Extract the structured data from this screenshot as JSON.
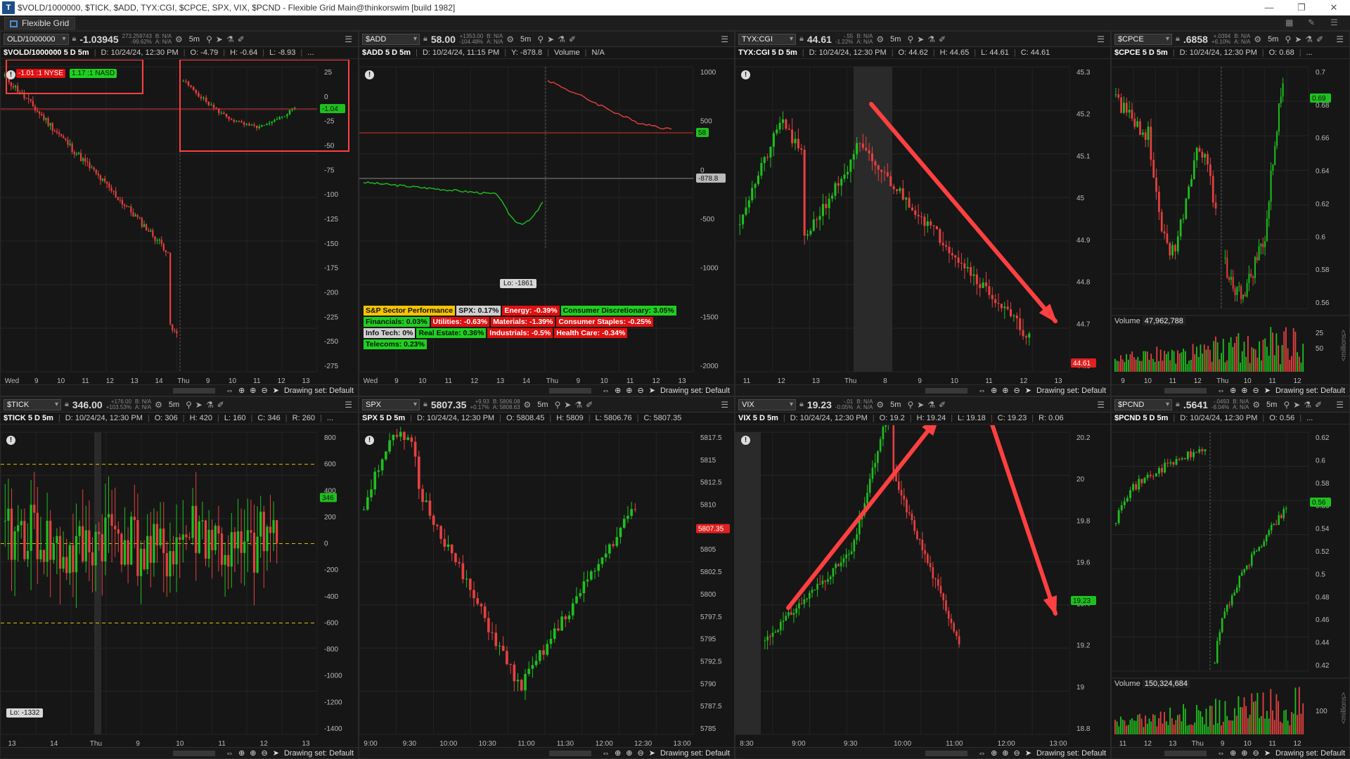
{
  "window": {
    "title": "$VOLD/1000000, $TICK, $ADD, TYX:CGI, $CPCE, SPX, VIX, $PCND - Flexible Grid Main@thinkorswim [build 1982]",
    "tab_label": "Flexible Grid"
  },
  "panels": [
    {
      "id": "vold",
      "symbol": "OLD/1000000",
      "last": "-1.03945",
      "change_top": "273.259743",
      "change_bottom": "-99.62%",
      "bid": "B: N/A",
      "ask": "A: N/A",
      "aggregation": "5m",
      "study_title": "$VOLD/1000000 5 D 5m",
      "fields": [
        "D: 10/24/24, 12:30 PM",
        "O: -4.79",
        "H: -0.64",
        "L: -8.93",
        "..."
      ],
      "x_ticks": [
        "Wed",
        "9",
        "10",
        "11",
        "12",
        "13",
        "14",
        "Thu",
        "9",
        "10",
        "11",
        "12",
        "13"
      ],
      "y_ticks": [
        "25",
        "0",
        "-25",
        "-50",
        "-75",
        "-100",
        "-125",
        "-150",
        "-175",
        "-200",
        "-225",
        "-250",
        "-275"
      ],
      "price_badge": "-1.04",
      "breadth_labels": [
        "-1.01 :1 NYSE",
        "1.17 :1 NASD"
      ]
    },
    {
      "id": "add",
      "symbol": "$ADD",
      "last": "58.00",
      "change_top": "+1353.00",
      "change_bottom": "-104.48%",
      "bid": "B: N/A",
      "ask": "A: N/A",
      "aggregation": "5m",
      "study_title": "$ADD 5 D 5m",
      "fields": [
        "D: 10/24/24, 11:15 PM",
        "Y: -878.8",
        "Volume",
        "N/A"
      ],
      "x_ticks": [
        "Wed",
        "9",
        "10",
        "11",
        "12",
        "13",
        "14",
        "Thu",
        "9",
        "10",
        "11",
        "12",
        "13"
      ],
      "y_ticks": [
        "1000",
        "500",
        "0",
        "-500",
        "-1000",
        "-1500",
        "-2000"
      ],
      "price_badge": "58",
      "ref_badge": "-878.8",
      "lo_label": "Lo: -1861",
      "sector_rows": [
        [
          {
            "text": "S&P Sector Performance",
            "bg": "#f5c400",
            "fg": "#111"
          },
          {
            "text": "SPX: 0.17%",
            "bg": "#d0d0d0",
            "fg": "#111"
          },
          {
            "text": "Energy: -0.39%",
            "bg": "#e01010",
            "fg": "#fff"
          },
          {
            "text": "Consumer Discretionary: 3.05%",
            "bg": "#1ed01e",
            "fg": "#111"
          }
        ],
        [
          {
            "text": "Financials: 0.03%",
            "bg": "#1ed01e",
            "fg": "#111"
          },
          {
            "text": "Utilities: -0.63%",
            "bg": "#e01010",
            "fg": "#fff"
          },
          {
            "text": "Materials: -1.39%",
            "bg": "#e01010",
            "fg": "#fff"
          },
          {
            "text": "Consumer Staples: -0.25%",
            "bg": "#e01010",
            "fg": "#fff"
          }
        ],
        [
          {
            "text": "Info Tech: 0%",
            "bg": "#d0d0d0",
            "fg": "#111"
          },
          {
            "text": "Real Estate: 0.36%",
            "bg": "#1ed01e",
            "fg": "#111"
          },
          {
            "text": "Industrials: -0.5%",
            "bg": "#e01010",
            "fg": "#fff"
          },
          {
            "text": "Health Care: -0.34%",
            "bg": "#e01010",
            "fg": "#fff"
          }
        ],
        [
          {
            "text": "Telecoms: 0.23%",
            "bg": "#1ed01e",
            "fg": "#111"
          }
        ]
      ]
    },
    {
      "id": "tyx",
      "symbol": "TYX:CGI",
      "last": "44.61",
      "change_top": "-.55",
      "change_bottom": "-1.22%",
      "bid": "B: N/A",
      "ask": "A: N/A",
      "aggregation": "5m",
      "study_title": "TYX:CGI 5 D 5m",
      "fields": [
        "D: 10/24/24, 12:30 PM",
        "O: 44.62",
        "H: 44.65",
        "L: 44.61",
        "C: 44.61"
      ],
      "x_ticks": [
        "11",
        "12",
        "13",
        "Thu",
        "8",
        "9",
        "10",
        "11",
        "12",
        "13"
      ],
      "y_ticks": [
        "45.3",
        "45.2",
        "45.1",
        "45",
        "44.9",
        "44.8",
        "44.7",
        "44.6"
      ],
      "price_badge": "44.61"
    },
    {
      "id": "cpce",
      "symbol": "$CPCE",
      "last": ".6858",
      "change_top": "+.0394",
      "change_bottom": "+6.10%",
      "bid": "B: N/A",
      "ask": "A: N/A",
      "aggregation": "5m",
      "study_title": "$CPCE 5 D 5m",
      "fields": [
        "D: 10/24/24, 12:30 PM",
        "O: 0.68",
        "..."
      ],
      "x_ticks": [
        "9",
        "10",
        "11",
        "12",
        "Thu",
        "10",
        "11",
        "12"
      ],
      "y_ticks": [
        "0.7",
        "0.68",
        "0.66",
        "0.64",
        "0.62",
        "0.6",
        "0.58",
        "0.56"
      ],
      "price_badge": "0.69",
      "volume_label": "Volume",
      "volume_value": "47,962,788",
      "volume_ticks": [
        "50",
        "25"
      ],
      "volume_side": "<millions>"
    },
    {
      "id": "tick",
      "symbol": "$TICK",
      "last": "346.00",
      "change_top": "+176.00",
      "change_bottom": "+103.53%",
      "bid": "B: N/A",
      "ask": "A: N/A",
      "aggregation": "5m",
      "study_title": "$TICK 5 D 5m",
      "fields": [
        "D: 10/24/24, 12:30 PM",
        "O: 306",
        "H: 420",
        "L: 160",
        "C: 346",
        "R: 260",
        "..."
      ],
      "x_ticks": [
        "13",
        "14",
        "Thu",
        "9",
        "10",
        "11",
        "12",
        "13"
      ],
      "y_ticks": [
        "800",
        "600",
        "400",
        "200",
        "0",
        "-200",
        "-400",
        "-600",
        "-800",
        "-1000",
        "-1200",
        "-1400"
      ],
      "price_badge": "346",
      "lo_label": "Lo: -1332"
    },
    {
      "id": "spx",
      "symbol": "SPX",
      "last": "5807.35",
      "change_top": "+9.93",
      "change_bottom": "+0.17%",
      "bid": "B: 5806.08",
      "ask": "A: 5808.63",
      "aggregation": "5m",
      "study_title": "SPX 5 D 5m",
      "fields": [
        "D: 10/24/24, 12:30 PM",
        "O: 5808.45",
        "H: 5809",
        "L: 5806.76",
        "C: 5807.35"
      ],
      "x_ticks": [
        "9:00",
        "9:30",
        "10:00",
        "10:30",
        "11:00",
        "11:30",
        "12:00",
        "12:30",
        "13:00"
      ],
      "y_ticks": [
        "5817.5",
        "5815",
        "5812.5",
        "5810",
        "5807.5",
        "5805",
        "5802.5",
        "5800",
        "5797.5",
        "5795",
        "5792.5",
        "5790",
        "5787.5",
        "5785"
      ],
      "price_badge": "5807.35"
    },
    {
      "id": "vix",
      "symbol": "VIX",
      "last": "19.23",
      "change_top": "-.01",
      "change_bottom": "-0.05%",
      "bid": "B: N/A",
      "ask": "A: N/A",
      "aggregation": "5m",
      "study_title": "VIX 5 D 5m",
      "fields": [
        "D: 10/24/24, 12:30 PM",
        "O: 19.2",
        "H: 19.24",
        "L: 19.18",
        "C: 19.23",
        "R: 0.06"
      ],
      "x_ticks": [
        "8:30",
        "9:00",
        "9:30",
        "10:00",
        "11:00",
        "12:00",
        "13:00"
      ],
      "y_ticks": [
        "20.2",
        "20",
        "19.8",
        "19.6",
        "19.4",
        "19.2",
        "19",
        "18.8"
      ],
      "price_badge": "19.23"
    },
    {
      "id": "pcnd",
      "symbol": "$PCND",
      "last": ".5641",
      "change_top": "-.0493",
      "change_bottom": "-8.04%",
      "bid": "B: N/A",
      "ask": "A: N/A",
      "aggregation": "5m",
      "study_title": "$PCND 5 D 5m",
      "fields": [
        "D: 10/24/24, 12:30 PM",
        "O: 0.56",
        "..."
      ],
      "x_ticks": [
        "11",
        "12",
        "13",
        "Thu",
        "9",
        "10",
        "11",
        "12"
      ],
      "y_ticks": [
        "0.62",
        "0.6",
        "0.58",
        "0.56",
        "0.54",
        "0.52",
        "0.5",
        "0.48",
        "0.46",
        "0.44",
        "0.42"
      ],
      "price_badge": "0.56",
      "volume_label": "Volume",
      "volume_value": "150,324,684",
      "volume_ticks": [
        "100"
      ],
      "volume_side": "<millions>"
    }
  ],
  "footer": {
    "drawing_set": "Drawing set: Default"
  },
  "icons": {
    "lock": "lock-icon",
    "settings": "gear-icon",
    "menu": "menu-icon",
    "zoom_in": "zoom-in-icon",
    "zoom_out": "zoom-out-icon",
    "pan": "pan-icon",
    "cursor": "cursor-icon"
  },
  "colors": {
    "up": "#1ec01e",
    "down": "#e64040",
    "price_badge_up": "#1ec01e",
    "price_badge_down": "#e02020",
    "annotation_arrow": "#ff4040",
    "annotation_box": "#ff4040",
    "ref_line": "#e03030",
    "threshold_line": "#e0c000"
  }
}
